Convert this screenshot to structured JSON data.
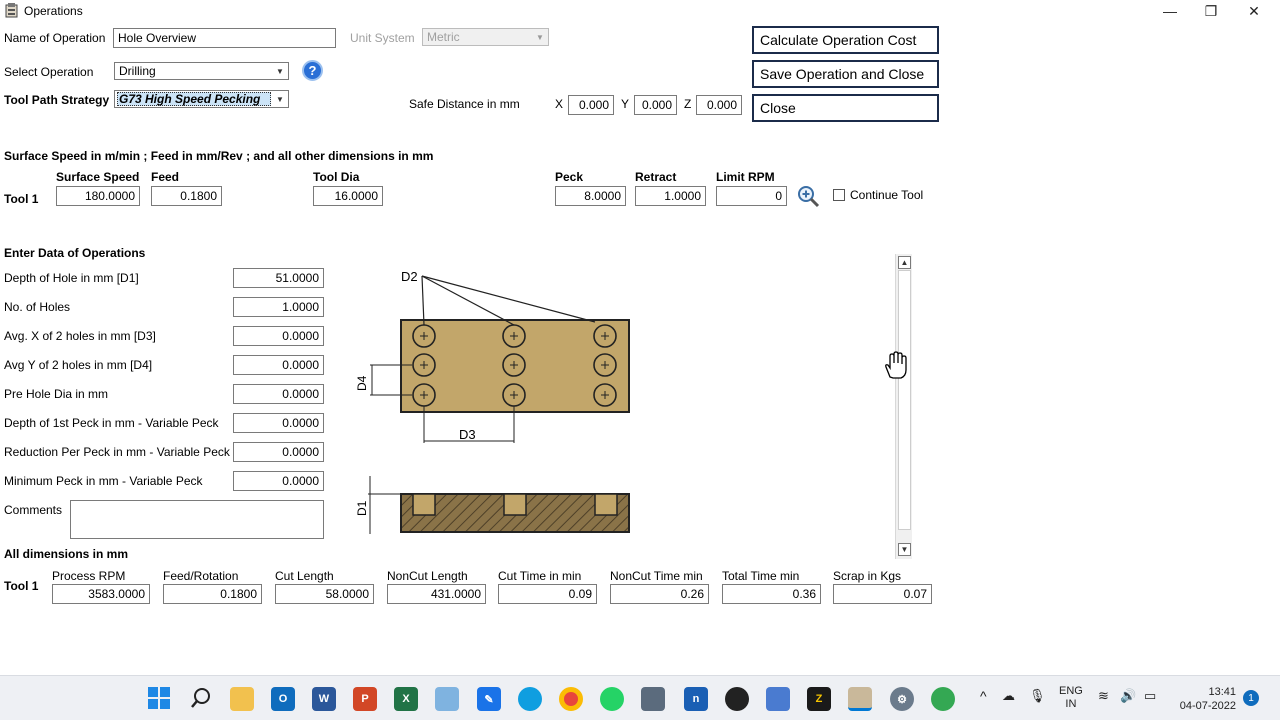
{
  "window": {
    "title": "Operations",
    "buttons": {
      "minimize": "—",
      "restore": "❐",
      "close": "✕"
    }
  },
  "operation": {
    "name_label": "Name of Operation",
    "name_value": "Hole Overview",
    "unit_label": "Unit System",
    "unit_value": "Metric",
    "select_label": "Select Operation",
    "select_value": "Drilling",
    "toolpath_label": "Tool Path Strategy",
    "toolpath_value": "G73 High Speed Pecking",
    "help_icon": "?"
  },
  "actions": {
    "calculate": "Calculate Operation Cost",
    "save_close": "Save Operation and Close",
    "close": "Close"
  },
  "safe_distance": {
    "label": "Safe Distance in mm",
    "x_label": "X",
    "x_value": "0.000",
    "y_label": "Y",
    "y_value": "0.000",
    "z_label": "Z",
    "z_value": "0.000"
  },
  "tooling": {
    "units_note": "Surface Speed in m/min ; Feed in mm/Rev ; and all other dimensions in mm",
    "tool_label": "Tool 1",
    "surface_speed_label": "Surface Speed",
    "surface_speed": "180.0000",
    "feed_label": "Feed",
    "feed": "0.1800",
    "tool_dia_label": "Tool Dia",
    "tool_dia": "16.0000",
    "peck_label": "Peck",
    "peck": "8.0000",
    "retract_label": "Retract",
    "retract": "1.0000",
    "limit_rpm_label": "Limit RPM",
    "limit_rpm": "0",
    "continue_tool_label": "Continue Tool",
    "continue_tool_checked": false
  },
  "ops_data": {
    "heading": "Enter Data of Operations",
    "rows": [
      {
        "label": "Depth of Hole in mm [D1]",
        "value": "51.0000"
      },
      {
        "label": "No. of Holes",
        "value": "1.0000"
      },
      {
        "label": "Avg. X of 2 holes in mm [D3]",
        "value": "0.0000"
      },
      {
        "label": "Avg Y of 2 holes in mm [D4]",
        "value": "0.0000"
      },
      {
        "label": "Pre Hole Dia in mm",
        "value": "0.0000"
      },
      {
        "label": "Depth of 1st Peck in mm - Variable Peck",
        "value": "0.0000"
      },
      {
        "label": "Reduction Per Peck in mm - Variable Peck",
        "value": "0.0000"
      },
      {
        "label": "Minimum Peck in mm - Variable Peck",
        "value": "0.0000"
      }
    ],
    "comments_label": "Comments",
    "comments_value": ""
  },
  "diagram": {
    "d1": "D1",
    "d2": "D2",
    "d3": "D3",
    "d4": "D4",
    "block_color": "#c2a66a"
  },
  "results": {
    "heading": "All dimensions in mm",
    "tool_label": "Tool 1",
    "columns": [
      {
        "label": "Process RPM",
        "value": "3583.0000"
      },
      {
        "label": "Feed/Rotation",
        "value": "0.1800"
      },
      {
        "label": "Cut Length",
        "value": "58.0000"
      },
      {
        "label": "NonCut Length",
        "value": "431.0000"
      },
      {
        "label": "Cut Time in min",
        "value": "0.09"
      },
      {
        "label": "NonCut Time min",
        "value": "0.26"
      },
      {
        "label": "Total Time min",
        "value": "0.36"
      },
      {
        "label": "Scrap in Kgs",
        "value": "0.07"
      }
    ]
  },
  "taskbar": {
    "lang_top": "ENG",
    "lang_bottom": "IN",
    "time": "13:41",
    "date": "04-07-2022",
    "notification_count": "1"
  }
}
